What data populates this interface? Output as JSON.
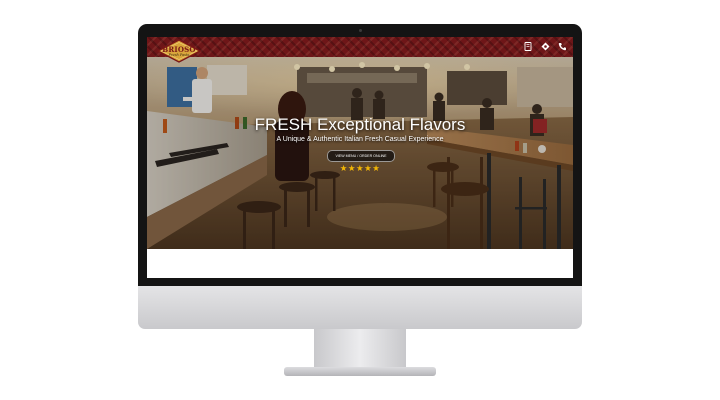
{
  "brand": {
    "name": "BRIOSO",
    "tagline": "Fresh Pasta",
    "logo_bg": "#d9a53b",
    "logo_border": "#7a1616"
  },
  "topbar": {
    "bg": "#6e1618",
    "icons": [
      "menu-book-icon",
      "location-pin-icon",
      "phone-icon"
    ]
  },
  "hero": {
    "headline": "FRESH Exceptional Flavors",
    "subheadline": "A Unique & Authentic Italian Fresh Casual Experience",
    "button_label": "VIEW MENU / ORDER ONLINE",
    "rating": 5,
    "rating_max": 5,
    "star_color": "#f2b705"
  }
}
